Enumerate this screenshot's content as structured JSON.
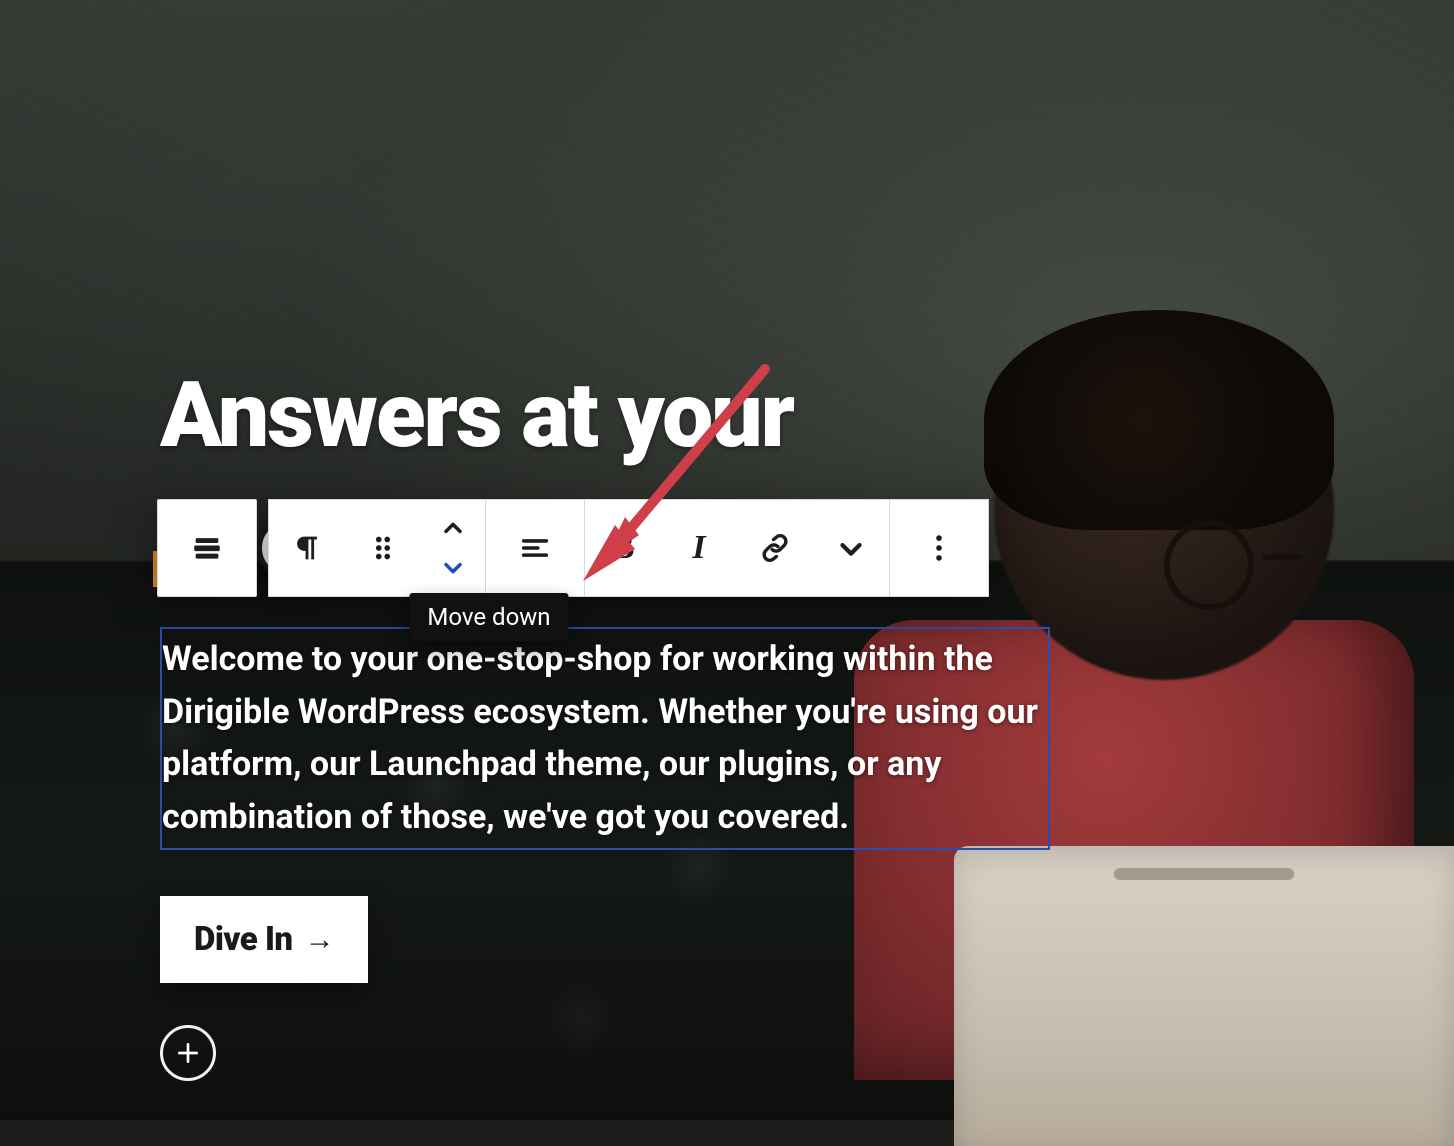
{
  "hero": {
    "heading_visible": "Answers at your",
    "paragraph": "Welcome to your one-stop-shop for working within the Dirigible WordPress ecosystem. Whether you're using our platform, our Launchpad theme, our plugins, or any combination of those, we've got you covered.",
    "cta_label": "Dive In",
    "cta_arrow": "→"
  },
  "toolbar": {
    "parent_block_icon": "stack-icon",
    "block_type_icon": "paragraph-icon",
    "drag_icon": "drag-handle-icon",
    "move_up_icon": "chevron-up-icon",
    "move_down_icon": "chevron-down-icon",
    "align_icon": "align-left-icon",
    "bold_label": "B",
    "italic_label": "I",
    "link_icon": "link-icon",
    "more_inline_icon": "chevron-down-icon",
    "overflow_icon": "more-vertical-icon"
  },
  "tooltip": {
    "move_down": "Move down"
  },
  "add_block_icon": "plus-icon",
  "colors": {
    "selection_border": "#2b4ea8",
    "arrow_annotation": "#cf3f4a"
  }
}
